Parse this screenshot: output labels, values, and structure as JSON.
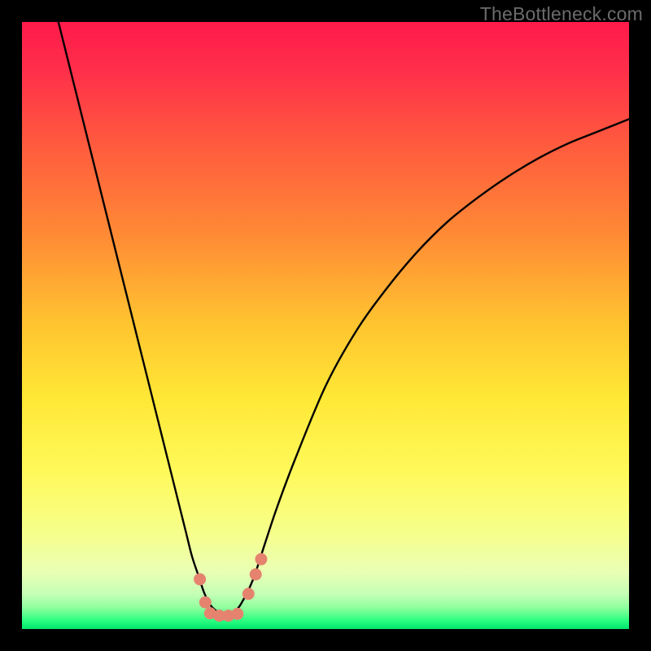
{
  "watermark": {
    "text": "TheBottleneck.com"
  },
  "colors": {
    "black": "#000000",
    "curve": "#000000",
    "marker_fill": "#e5836f",
    "marker_stroke": "#c36d5a",
    "gradient_stops": [
      {
        "offset": 0.0,
        "color": "#ff1a4b"
      },
      {
        "offset": 0.08,
        "color": "#ff2f4a"
      },
      {
        "offset": 0.2,
        "color": "#ff5a3e"
      },
      {
        "offset": 0.35,
        "color": "#ff8a35"
      },
      {
        "offset": 0.5,
        "color": "#ffc530"
      },
      {
        "offset": 0.62,
        "color": "#ffe836"
      },
      {
        "offset": 0.74,
        "color": "#fff95a"
      },
      {
        "offset": 0.84,
        "color": "#f6ff8a"
      },
      {
        "offset": 0.905,
        "color": "#eaffb4"
      },
      {
        "offset": 0.942,
        "color": "#c6ffb6"
      },
      {
        "offset": 0.965,
        "color": "#8fff9e"
      },
      {
        "offset": 0.985,
        "color": "#2fff82"
      },
      {
        "offset": 1.0,
        "color": "#00e66a"
      }
    ]
  },
  "chart_data": {
    "type": "line",
    "title": "",
    "xlabel": "",
    "ylabel": "",
    "xlim": [
      0,
      100
    ],
    "ylim": [
      0,
      100
    ],
    "series": [
      {
        "name": "bottleneck-curve",
        "x": [
          6,
          8,
          10,
          12,
          14,
          16,
          18,
          20,
          22,
          24,
          26,
          27,
          28,
          29,
          30,
          31,
          32,
          33,
          34,
          35,
          36,
          38,
          40,
          42,
          45,
          50,
          55,
          60,
          65,
          70,
          75,
          80,
          85,
          90,
          95,
          100
        ],
        "y": [
          100,
          92,
          84,
          76,
          68,
          60,
          52,
          44,
          36,
          28,
          20,
          16,
          12,
          9,
          6,
          4,
          3,
          2.5,
          2.5,
          3,
          4,
          8,
          14,
          20,
          28,
          40,
          49,
          56,
          62,
          67,
          71,
          74.5,
          77.5,
          80,
          82,
          84
        ]
      }
    ],
    "markers": {
      "name": "highlight-points",
      "points": [
        {
          "x": 29.3,
          "y": 8.2,
          "r": 1.0
        },
        {
          "x": 30.2,
          "y": 4.4,
          "r": 1.0
        },
        {
          "x": 31.0,
          "y": 2.6,
          "r": 1.0
        },
        {
          "x": 32.5,
          "y": 2.2,
          "r": 1.0
        },
        {
          "x": 34.0,
          "y": 2.2,
          "r": 1.0
        },
        {
          "x": 35.5,
          "y": 2.5,
          "r": 1.0
        },
        {
          "x": 37.3,
          "y": 5.8,
          "r": 1.0
        },
        {
          "x": 38.5,
          "y": 9.0,
          "r": 1.0
        },
        {
          "x": 39.4,
          "y": 11.5,
          "r": 1.0
        }
      ]
    }
  }
}
